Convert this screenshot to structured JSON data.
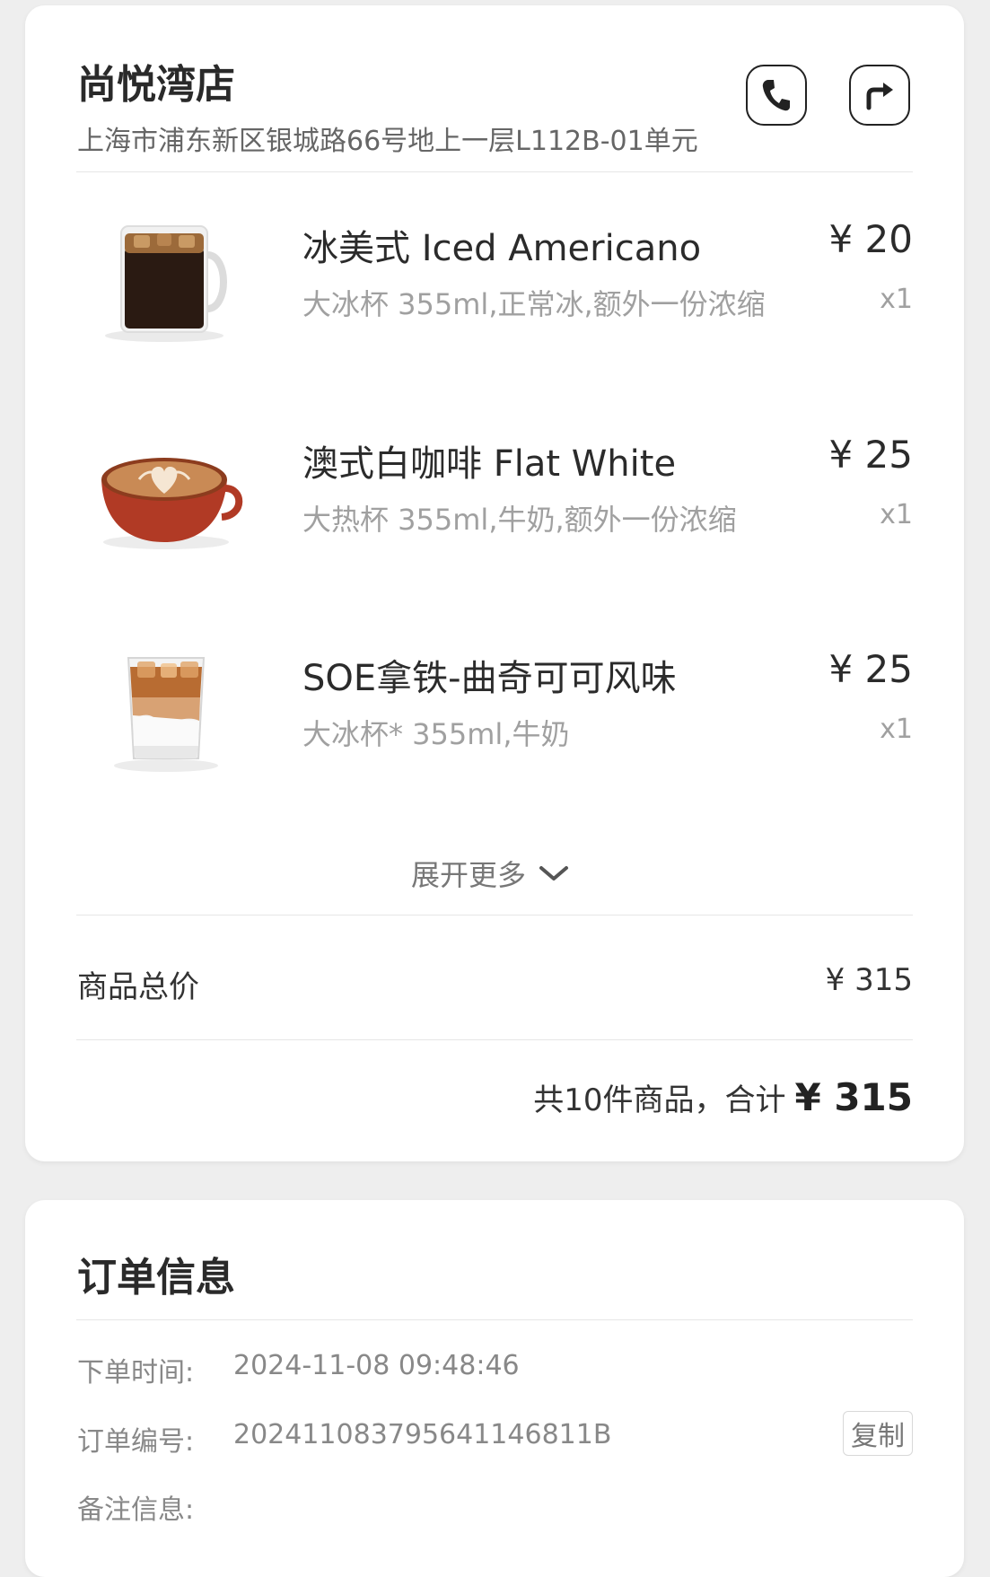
{
  "store": {
    "name": "尚悦湾店",
    "address": "上海市浦东新区银城路66号地上一层L112B-01单元"
  },
  "items": [
    {
      "name": "冰美式 Iced Americano",
      "options": "大冰杯 355ml,正常冰,额外一份浓缩",
      "price": "¥ 20",
      "qty": "x1",
      "image": "iced-americano-glass-mug"
    },
    {
      "name": "澳式白咖啡 Flat White",
      "options": "大热杯 355ml,牛奶,额外一份浓缩",
      "price": "¥ 25",
      "qty": "x1",
      "image": "flat-white-red-cup-latte-art"
    },
    {
      "name": "SOE拿铁-曲奇可可风味",
      "options": "大冰杯* 355ml,牛奶",
      "price": "¥ 25",
      "qty": "x1",
      "image": "iced-latte-glass"
    }
  ],
  "expand_more": {
    "label": "展开更多"
  },
  "summary": {
    "subtotal_label": "商品总价",
    "subtotal_value": "¥ 315",
    "total_text": "共10件商品，合计",
    "total_value": "¥ 315"
  },
  "order_info": {
    "title": "订单信息",
    "time_label": "下单时间:",
    "time_value": "2024-11-08 09:48:46",
    "number_label": "订单编号:",
    "number_value": "20241108379564114681 1B",
    "copy_label": "复制",
    "remark_label": "备注信息:"
  },
  "colors": {
    "page_background": "#eeeeee",
    "card_background": "#ffffff",
    "primary_text": "#2b2b2b",
    "secondary_text": "#a0a0a0"
  }
}
